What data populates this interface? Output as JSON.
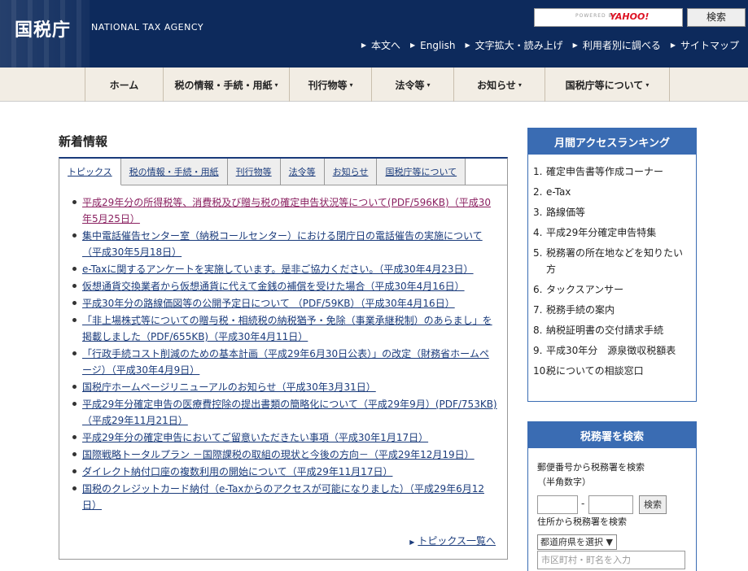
{
  "header": {
    "logo_ja": "国税庁",
    "logo_en": "NATIONAL TAX AGENCY",
    "search": {
      "powered_by": "POWERED BY",
      "engine": "YAHOO!",
      "button": "検索"
    },
    "util_links": [
      "本文へ",
      "English",
      "文字拡大・読み上げ",
      "利用者別に調べる",
      "サイトマップ"
    ]
  },
  "nav": {
    "items": [
      {
        "label": "ホーム",
        "has_menu": false
      },
      {
        "label": "税の情報・手続・用紙",
        "has_menu": true
      },
      {
        "label": "刊行物等",
        "has_menu": true
      },
      {
        "label": "法令等",
        "has_menu": true
      },
      {
        "label": "お知らせ",
        "has_menu": true
      },
      {
        "label": "国税庁等について",
        "has_menu": true
      }
    ]
  },
  "news": {
    "heading": "新着情報",
    "tabs": [
      "トピックス",
      "税の情報・手続・用紙",
      "刊行物等",
      "法令等",
      "お知らせ",
      "国税庁等について"
    ],
    "active_tab": "トピックス",
    "topics": [
      {
        "text": "平成29年分の所得税等、消費税及び贈与税の確定申告状況等について(PDF/596KB)（平成30年5月25日）",
        "visited": true
      },
      {
        "text": "集中電話催告センター室（納税コールセンター）における閉庁日の電話催告の実施について（平成30年5月18日）",
        "visited": false
      },
      {
        "text": "e-Taxに関するアンケートを実施しています。是非ご協力ください。（平成30年4月23日）",
        "visited": false
      },
      {
        "text": "仮想通貨交換業者から仮想通貨に代えて金銭の補償を受けた場合（平成30年4月16日）",
        "visited": false
      },
      {
        "text": "平成30年分の路線価図等の公開予定日について （PDF/59KB）（平成30年4月16日）",
        "visited": false
      },
      {
        "text": "「非上場株式等についての贈与税・相続税の納税猶予・免除（事業承継税制）のあらまし」を掲載しました（PDF/655KB)（平成30年4月11日）",
        "visited": false
      },
      {
        "text": "「行政手続コスト削減のための基本計画（平成29年6月30日公表）」の改定（財務省ホームページ）（平成30年4月9日）",
        "visited": false
      },
      {
        "text": "国税庁ホームページリニューアルのお知らせ（平成30年3月31日）",
        "visited": false
      },
      {
        "text": "平成29年分確定申告の医療費控除の提出書類の簡略化について（平成29年9月）(PDF/753KB)（平成29年11月21日）",
        "visited": false
      },
      {
        "text": "平成29年分の確定申告においてご留意いただきたい事項（平成30年1月17日）",
        "visited": false
      },
      {
        "text": "国際戦略トータルプラン －国際課税の取組の現状と今後の方向－（平成29年12月19日）",
        "visited": false
      },
      {
        "text": "ダイレクト納付口座の複数利用の開始について（平成29年11月17日）",
        "visited": false
      },
      {
        "text": "国税のクレジットカード納付（e-Taxからのアクセスが可能になりました）（平成29年6月12日）",
        "visited": false
      }
    ],
    "more_link": "トピックス一覧へ"
  },
  "ranking": {
    "heading": "月間アクセスランキング",
    "items": [
      {
        "num": "1.",
        "label": "確定申告書等作成コーナー"
      },
      {
        "num": "2.",
        "label": "e-Tax"
      },
      {
        "num": "3.",
        "label": "路線価等"
      },
      {
        "num": "4.",
        "label": "平成29年分確定申告特集"
      },
      {
        "num": "5.",
        "label": "税務署の所在地などを知りたい方"
      },
      {
        "num": "6.",
        "label": "タックスアンサー"
      },
      {
        "num": "7.",
        "label": "税務手続の案内"
      },
      {
        "num": "8.",
        "label": "納税証明書の交付請求手続"
      },
      {
        "num": "9.",
        "label": "平成30年分　源泉徴収税額表"
      },
      {
        "num": "10.",
        "label": "税についての相談窓口"
      }
    ]
  },
  "office_search": {
    "heading": "税務署を検索",
    "zip_label_1": "郵便番号から税務署を検索",
    "zip_label_2": "（半角数字）",
    "zip_dash": "-",
    "zip_button": "検索",
    "address_label": "住所から税務署を検索",
    "prefecture_select": "都道府県を選択 ▼",
    "city_placeholder": "市区町村・町名を入力"
  }
}
